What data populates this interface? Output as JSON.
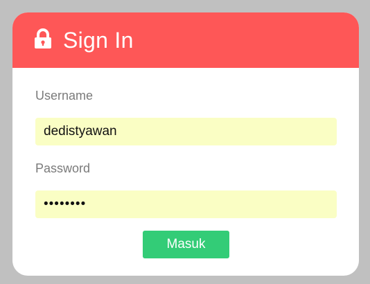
{
  "header": {
    "icon": "lock-icon",
    "title": "Sign In",
    "color": "#fe5757"
  },
  "form": {
    "username_label": "Username",
    "username_value": "dedistyawan",
    "password_label": "Password",
    "password_value": "dedistya",
    "input_background": "#fafec4",
    "submit_label": "Masuk",
    "submit_color": "#33cc77"
  }
}
